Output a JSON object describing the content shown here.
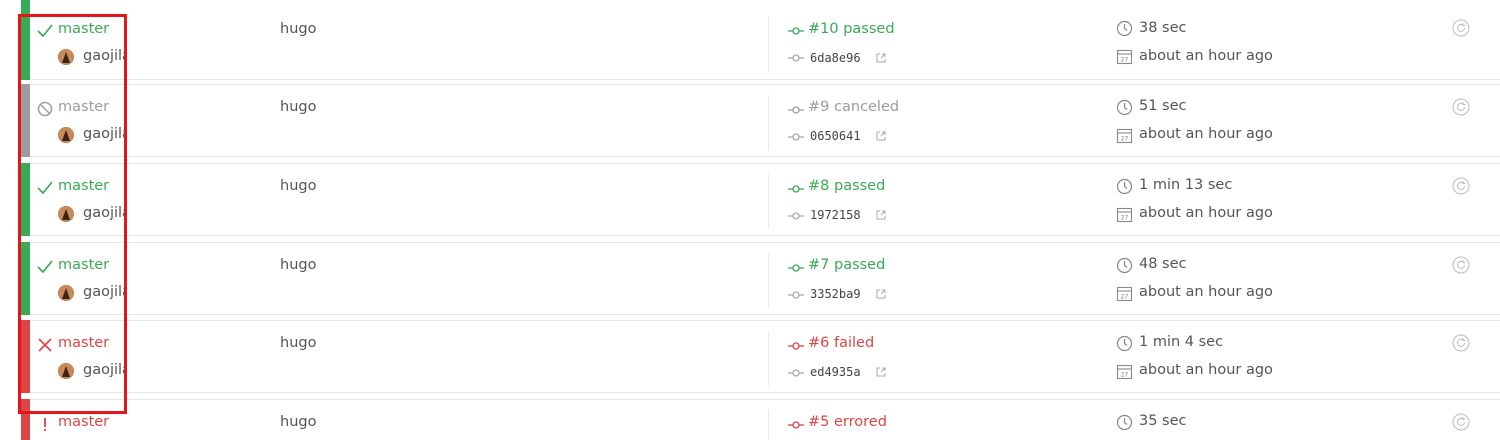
{
  "colors": {
    "passed": "#39aa56",
    "canceled": "#9d9d9d",
    "failed": "#db4545",
    "errored": "#db4545",
    "highlight": "#e8141c"
  },
  "builds": [
    {
      "state": "passed",
      "status_icon": "check-icon",
      "branch": "master",
      "author": "gaojila",
      "message": "hugo",
      "build": "#10 passed",
      "sha": "6da8e96",
      "duration": "38 sec",
      "finished": "about an hour ago"
    },
    {
      "state": "canceled",
      "status_icon": "canceled-icon",
      "branch": "master",
      "author": "gaojila",
      "message": "hugo",
      "build": "#9 canceled",
      "sha": "0650641",
      "duration": "51 sec",
      "finished": "about an hour ago"
    },
    {
      "state": "passed",
      "status_icon": "check-icon",
      "branch": "master",
      "author": "gaojila",
      "message": "hugo",
      "build": "#8 passed",
      "sha": "1972158",
      "duration": "1 min 13 sec",
      "finished": "about an hour ago"
    },
    {
      "state": "passed",
      "status_icon": "check-icon",
      "branch": "master",
      "author": "gaojila",
      "message": "hugo",
      "build": "#7 passed",
      "sha": "3352ba9",
      "duration": "48 sec",
      "finished": "about an hour ago"
    },
    {
      "state": "failed",
      "status_icon": "cross-icon",
      "branch": "master",
      "author": "gaojila",
      "message": "hugo",
      "build": "#6 failed",
      "sha": "ed4935a",
      "duration": "1 min 4 sec",
      "finished": "about an hour ago"
    },
    {
      "state": "errored",
      "status_icon": "exclamation-icon",
      "branch": "master",
      "author": "",
      "message": "hugo",
      "build": "#5 errored",
      "sha": "",
      "duration": "35 sec",
      "finished": ""
    }
  ]
}
